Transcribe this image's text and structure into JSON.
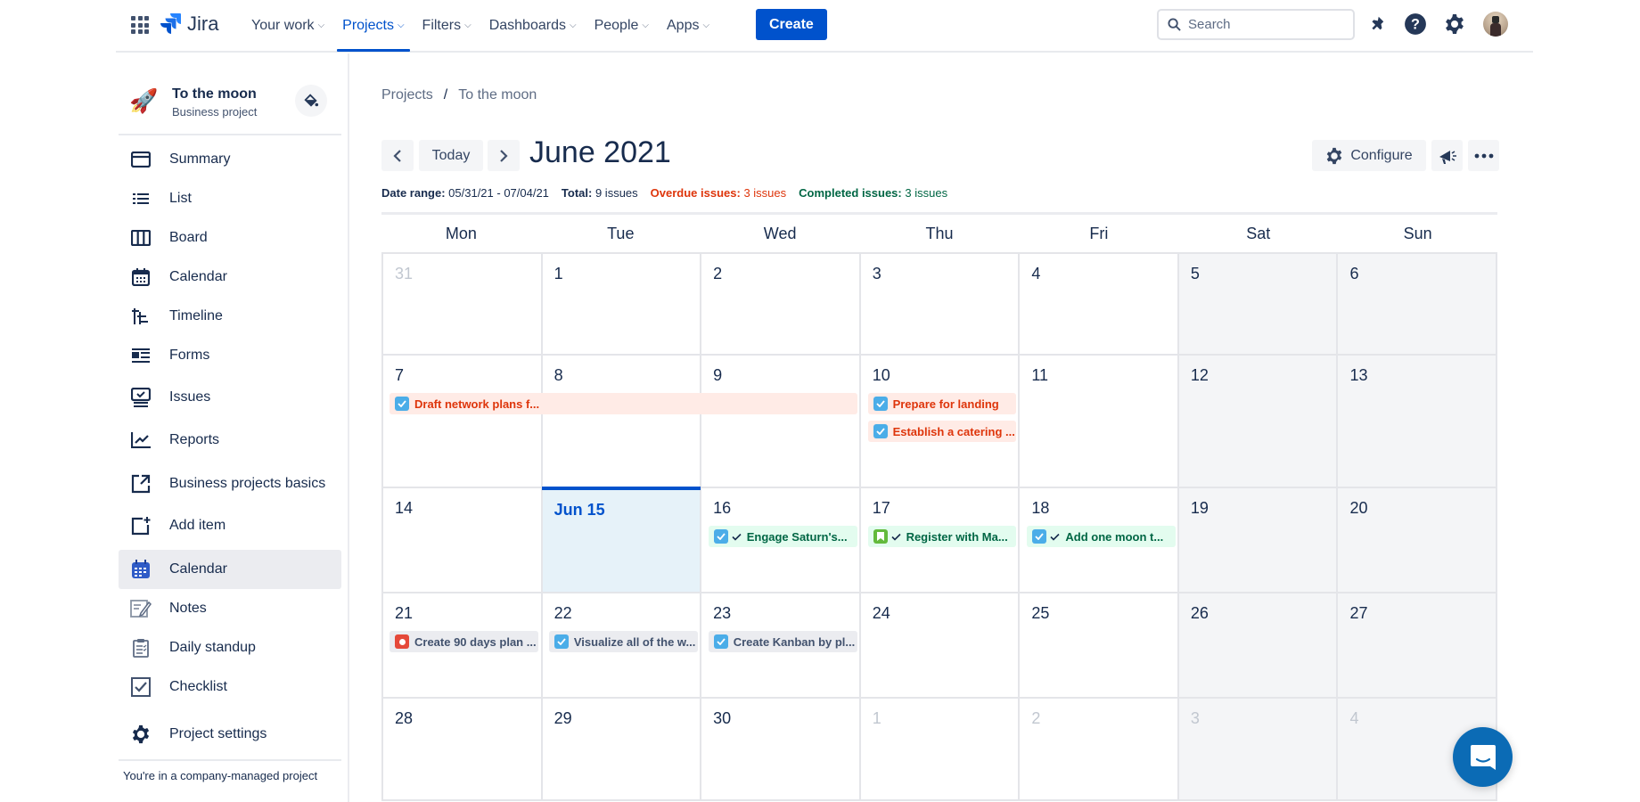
{
  "topbar": {
    "logo_text": "Jira",
    "nav": [
      {
        "label": "Your work",
        "active": false
      },
      {
        "label": "Projects",
        "active": true
      },
      {
        "label": "Filters",
        "active": false
      },
      {
        "label": "Dashboards",
        "active": false
      },
      {
        "label": "People",
        "active": false
      },
      {
        "label": "Apps",
        "active": false
      }
    ],
    "create_label": "Create",
    "search_placeholder": "Search"
  },
  "sidebar": {
    "project_name": "To the moon",
    "project_type": "Business project",
    "items": [
      {
        "label": "Summary",
        "icon": "summary-icon"
      },
      {
        "label": "List",
        "icon": "list-icon"
      },
      {
        "label": "Board",
        "icon": "board-icon"
      },
      {
        "label": "Calendar",
        "icon": "calendar-icon"
      },
      {
        "label": "Timeline",
        "icon": "timeline-icon"
      },
      {
        "label": "Forms",
        "icon": "forms-icon"
      },
      {
        "label": "Issues",
        "icon": "issues-icon"
      },
      {
        "label": "Reports",
        "icon": "reports-icon"
      },
      {
        "label": "Business projects basics",
        "icon": "external-link-icon"
      },
      {
        "label": "Add item",
        "icon": "add-item-icon"
      },
      {
        "label": "Calendar",
        "icon": "calendar-app-icon",
        "selected": true
      },
      {
        "label": "Notes",
        "icon": "notes-icon"
      },
      {
        "label": "Daily standup",
        "icon": "clipboard-icon"
      },
      {
        "label": "Checklist",
        "icon": "checklist-icon"
      },
      {
        "label": "Project settings",
        "icon": "gear-icon"
      }
    ],
    "footer_note": "You're in a company-managed project"
  },
  "breadcrumb": [
    "Projects",
    "To the moon"
  ],
  "calendar": {
    "today_label": "Today",
    "month_title": "June 2021",
    "configure_label": "Configure",
    "stats": {
      "date_range_label": "Date range:",
      "date_range_value": "05/31/21 - 07/04/21",
      "total_label": "Total:",
      "total_value": "9 issues",
      "overdue_label": "Overdue issues:",
      "overdue_value": "3 issues",
      "completed_label": "Completed issues:",
      "completed_value": "3 issues"
    },
    "weekdays": [
      "Mon",
      "Tue",
      "Wed",
      "Thu",
      "Fri",
      "Sat",
      "Sun"
    ],
    "weeks": [
      {
        "days": [
          {
            "n": "31",
            "other": true
          },
          {
            "n": "1"
          },
          {
            "n": "2"
          },
          {
            "n": "3"
          },
          {
            "n": "4"
          },
          {
            "n": "5"
          },
          {
            "n": "6"
          }
        ]
      },
      {
        "days": [
          {
            "n": "7"
          },
          {
            "n": "8"
          },
          {
            "n": "9"
          },
          {
            "n": "10"
          },
          {
            "n": "11"
          },
          {
            "n": "12"
          },
          {
            "n": "13"
          }
        ]
      },
      {
        "days": [
          {
            "n": "14"
          },
          {
            "n": "Jun 15",
            "today": true
          },
          {
            "n": "16"
          },
          {
            "n": "17"
          },
          {
            "n": "18"
          },
          {
            "n": "19"
          },
          {
            "n": "20"
          }
        ]
      },
      {
        "days": [
          {
            "n": "21"
          },
          {
            "n": "22"
          },
          {
            "n": "23"
          },
          {
            "n": "24"
          },
          {
            "n": "25"
          },
          {
            "n": "26"
          },
          {
            "n": "27"
          }
        ]
      },
      {
        "days": [
          {
            "n": "28"
          },
          {
            "n": "29"
          },
          {
            "n": "30"
          },
          {
            "n": "1",
            "other": true
          },
          {
            "n": "2",
            "other": true
          },
          {
            "n": "3",
            "other": true
          },
          {
            "n": "4",
            "other": true
          }
        ]
      }
    ],
    "events": [
      {
        "week": 1,
        "start": 0,
        "span": 3,
        "row": 0,
        "status": "overdue",
        "type": "task",
        "title": "Draft network plans f..."
      },
      {
        "week": 1,
        "start": 3,
        "span": 1,
        "row": 0,
        "status": "overdue",
        "type": "task",
        "title": "Prepare for landing"
      },
      {
        "week": 1,
        "start": 3,
        "span": 1,
        "row": 1,
        "status": "overdue",
        "type": "task",
        "title": "Establish a catering ..."
      },
      {
        "week": 2,
        "start": 2,
        "span": 1,
        "row": 0,
        "status": "done",
        "type": "task",
        "title": "Engage Saturn's..."
      },
      {
        "week": 2,
        "start": 3,
        "span": 1,
        "row": 0,
        "status": "done",
        "type": "story",
        "title": "Register with Ma..."
      },
      {
        "week": 2,
        "start": 4,
        "span": 1,
        "row": 0,
        "status": "done",
        "type": "task",
        "title": "Add one moon t..."
      },
      {
        "week": 3,
        "start": 0,
        "span": 1,
        "row": 0,
        "status": "normal",
        "type": "bug",
        "title": "Create 90 days plan ..."
      },
      {
        "week": 3,
        "start": 1,
        "span": 1,
        "row": 0,
        "status": "normal",
        "type": "task",
        "title": "Visualize all of the w..."
      },
      {
        "week": 3,
        "start": 2,
        "span": 1,
        "row": 0,
        "status": "normal",
        "type": "task",
        "title": "Create Kanban by pl..."
      }
    ]
  },
  "colors": {
    "brand": "#0052CC",
    "overdue": "#DE350B",
    "completed": "#006644",
    "today_bg": "#E6F2F9"
  }
}
